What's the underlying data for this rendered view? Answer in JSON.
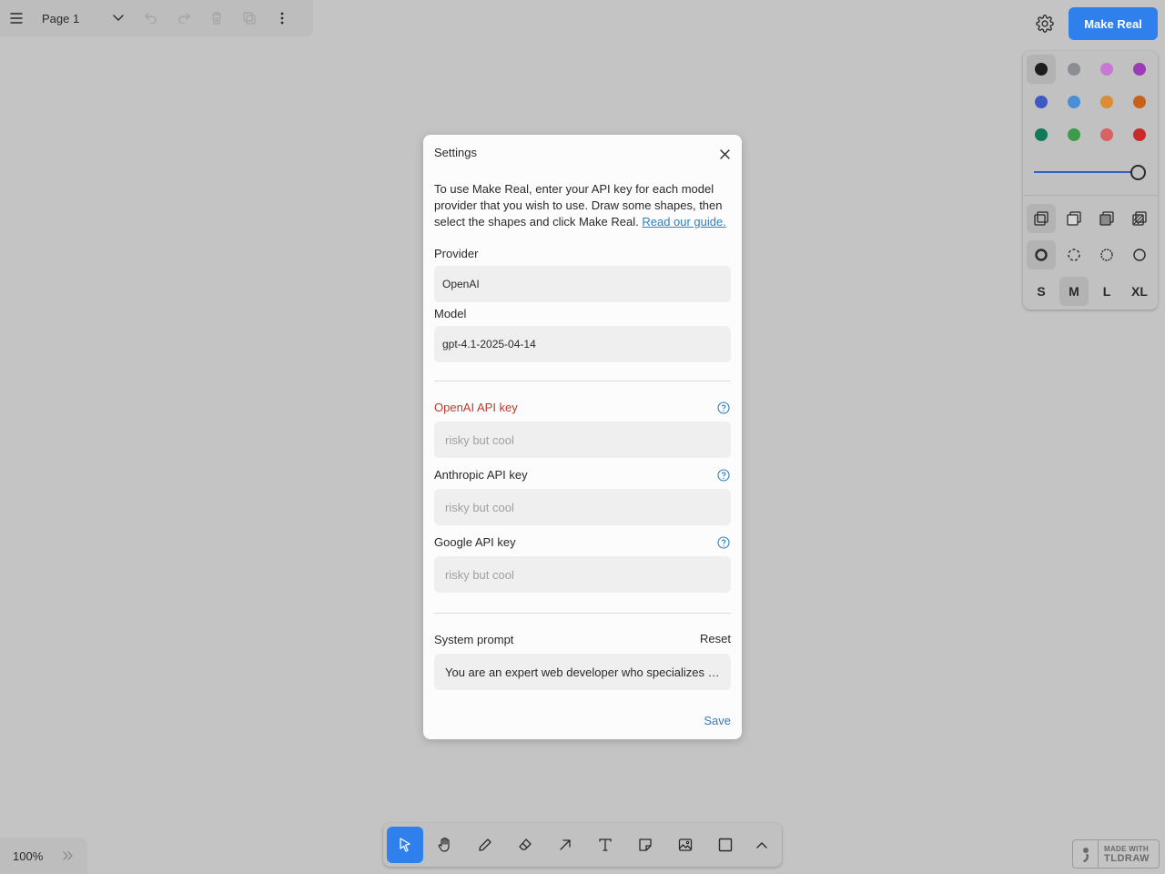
{
  "page_menu": {
    "page_name": "Page 1",
    "icons": [
      "hamburger-icon",
      "chevron-down-icon",
      "undo-icon",
      "redo-icon",
      "trash-icon",
      "duplicate-icon",
      "more-vertical-icon"
    ]
  },
  "top_right": {
    "settings_icon": "gear-icon",
    "make_real_label": "Make Real",
    "make_real_color": "#2f80ed"
  },
  "style_panel": {
    "colors": [
      "#1d1d1d",
      "#8a8d91",
      "#c978d6",
      "#9b3bb5",
      "#3c58c4",
      "#4a8ed8",
      "#dc8c34",
      "#c6621a",
      "#117a5a",
      "#3d9c4c",
      "#d86163",
      "#c82d2d"
    ],
    "selected_color": "#1d1d1d",
    "opacity": 1.0,
    "fill_icons": [
      "fill-none-icon",
      "fill-semi-icon",
      "fill-solid-icon",
      "fill-pattern-icon"
    ],
    "dash_icons": [
      "dash-draw-icon",
      "dash-dashed-icon",
      "dash-dotted-icon",
      "dash-solid-icon"
    ],
    "sizes": [
      "S",
      "M",
      "L",
      "XL"
    ],
    "selected_size": "M"
  },
  "modal": {
    "title": "Settings",
    "intro_text": "To use Make Real, enter your API key for each model provider that you wish to use. Draw some shapes, then select the shapes and click Make Real. ",
    "intro_link": "Read our guide.",
    "provider_label": "Provider",
    "provider_value": "OpenAI",
    "model_label": "Model",
    "model_value": "gpt-4.1-2025-04-14",
    "api_keys": [
      {
        "label": "OpenAI API key",
        "placeholder": "risky but cool",
        "required_highlight": true
      },
      {
        "label": "Anthropic API key",
        "placeholder": "risky but cool",
        "required_highlight": false
      },
      {
        "label": "Google API key",
        "placeholder": "risky but cool",
        "required_highlight": false
      }
    ],
    "system_prompt_label": "System prompt",
    "reset_label": "Reset",
    "system_prompt_value": "You are an expert web developer who specializes in building working website prototypes from low-fidelity wireframes.",
    "save_label": "Save",
    "link_color": "#2f7fc1",
    "required_color": "#c0392b"
  },
  "zoom": {
    "level": "100%"
  },
  "toolbar": {
    "tools": [
      "select-icon",
      "hand-icon",
      "draw-icon",
      "eraser-icon",
      "arrow-icon",
      "text-icon",
      "note-icon",
      "image-icon",
      "rectangle-icon",
      "chevron-up-icon"
    ],
    "active_tool": "select-icon"
  },
  "badge": {
    "line1": "MADE WITH",
    "line2": "TLDRAW"
  }
}
